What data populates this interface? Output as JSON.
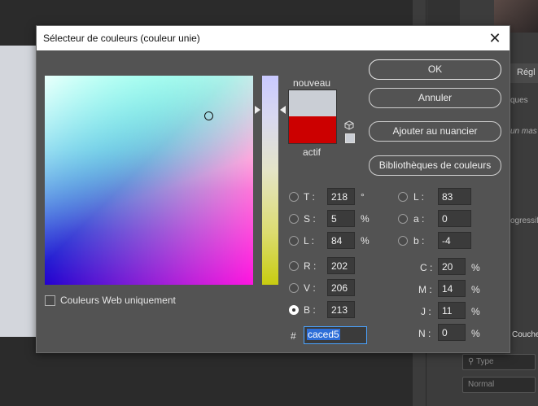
{
  "background": {
    "tab_label": "Régl",
    "snippet1": "ques",
    "snippet2": "un mas",
    "snippet3": "ogressif",
    "snippet4": "Couche",
    "type_placeholder": "Type",
    "blend_mode": "Normal"
  },
  "dialog": {
    "title": "Sélecteur de couleurs (couleur unie)",
    "new_label": "nouveau",
    "current_label": "actif",
    "web_only_label": "Couleurs Web uniquement",
    "buttons": {
      "ok": "OK",
      "cancel": "Annuler",
      "add_swatch": "Ajouter au nuancier",
      "libraries": "Bibliothèques de couleurs"
    },
    "hsb": {
      "h_label": "T :",
      "h_value": "218",
      "h_unit": "°",
      "s_label": "S :",
      "s_value": "5",
      "s_unit": "%",
      "b_label": "L :",
      "b_value": "84",
      "b_unit": "%"
    },
    "rgb": {
      "r_label": "R :",
      "r_value": "202",
      "g_label": "V :",
      "g_value": "206",
      "b_label": "B :",
      "b_value": "213"
    },
    "lab": {
      "l_label": "L :",
      "l_value": "83",
      "a_label": "a :",
      "a_value": "0",
      "b_label": "b :",
      "b_value": "-4"
    },
    "cmyk": {
      "c_label": "C :",
      "c_value": "20",
      "c_unit": "%",
      "m_label": "M :",
      "m_value": "14",
      "m_unit": "%",
      "y_label": "J :",
      "y_value": "11",
      "y_unit": "%",
      "k_label": "N :",
      "k_value": "0",
      "k_unit": "%"
    },
    "hex_label": "#",
    "hex_value": "caced5",
    "colors": {
      "new_color": "#caced5",
      "current_color": "#cc0000"
    }
  }
}
